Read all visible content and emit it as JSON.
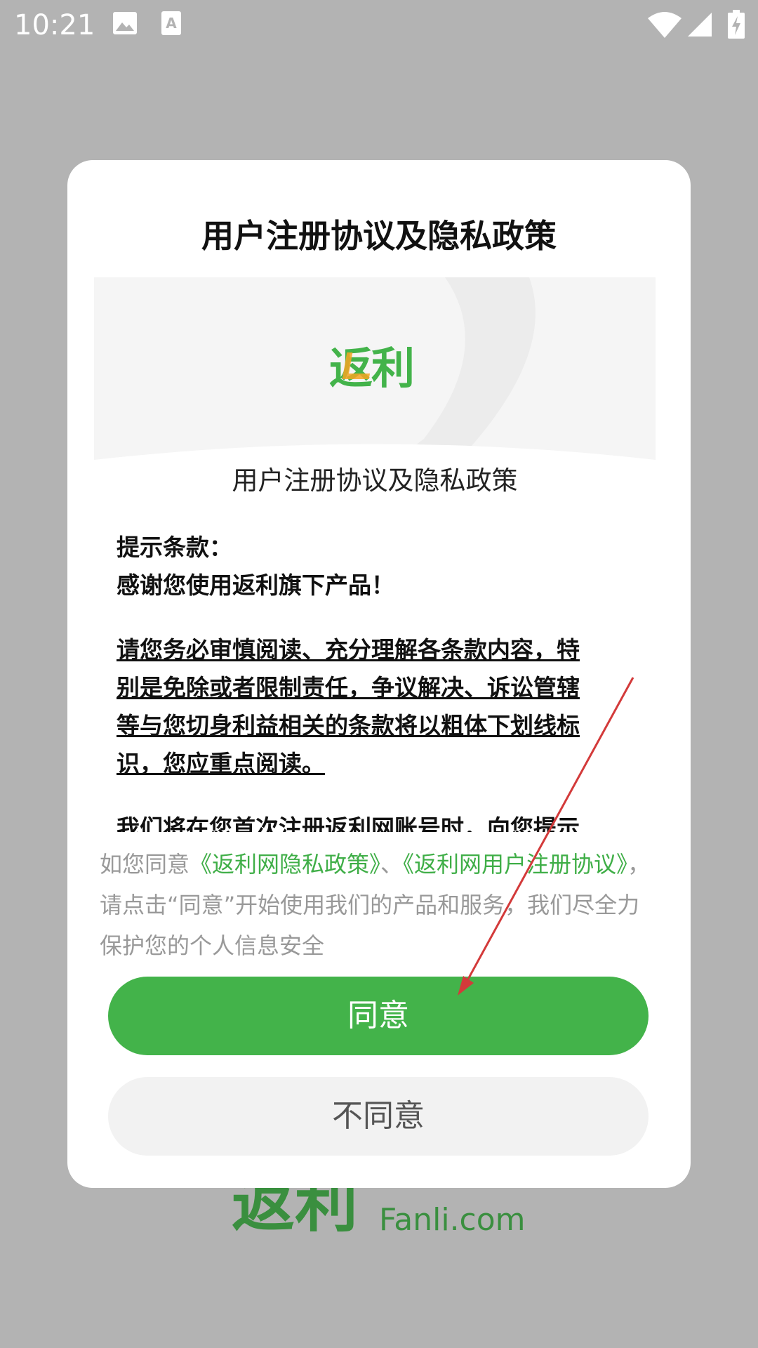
{
  "status_bar": {
    "time": "10:21",
    "icons": [
      "image-icon",
      "font-a-icon",
      "wifi-icon",
      "signal-icon",
      "battery-charging-icon"
    ]
  },
  "background": {
    "brand_logo_text": "返利",
    "brand_domain": "Fanli.com"
  },
  "dialog": {
    "title": "用户注册协议及隐私政策",
    "content": {
      "banner_logo": "返利",
      "doc_title": "用户注册协议及隐私政策",
      "paragraphs": [
        "提示条款：",
        "感谢您使用返利旗下产品！",
        "请您务必审慎阅读、充分理解各条款内容，特",
        "别是免除或者限制责任，争议解决、诉讼管辖",
        "等与您切身利益相关的条款将以粗体下划线标",
        "识，您应重点阅读。",
        "我们将在您首次注册返利网账号时，向您提示"
      ]
    },
    "consent": {
      "prefix": "如您同意",
      "privacy_link": "《返利网隐私政策》",
      "separator": "、",
      "terms_link": "《返利网用户注册协议》",
      "suffix": "，请点击“同意”开始使用我们的产品和服务，我们尽全力保护您的个人信息安全"
    },
    "agree_label": "同意",
    "disagree_label": "不同意"
  },
  "colors": {
    "accent_green": "#43b34a",
    "link_green": "#3fae47",
    "logo_orange": "#f5a623",
    "overlay_gray": "#b3b3b3"
  }
}
